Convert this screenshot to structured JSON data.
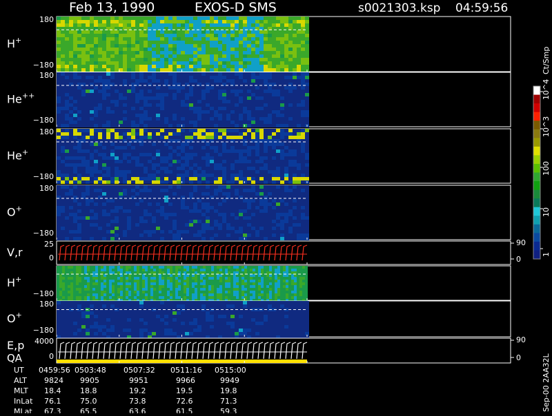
{
  "header": {
    "date": "Feb 13, 1990",
    "title": "EXOS-D SMS",
    "file": "s0021303.ksp",
    "time": "04:59:56"
  },
  "footer_stamp": "Sep-00 2AA32L",
  "colorbar": {
    "unit_label": "Ct/Smp",
    "tick_labels": [
      "10^4",
      "10^3",
      "100",
      "10",
      "1"
    ],
    "colors": [
      "#ffffff",
      "#a00000",
      "#d00000",
      "#ff2000",
      "#7a5a00",
      "#8a7a10",
      "#9a9a00",
      "#e0e000",
      "#9ad000",
      "#5ac000",
      "#30a830",
      "#10a010",
      "#1a8a3a",
      "#0a7a5a",
      "#20c8d8",
      "#10a0b0",
      "#0a6a9a",
      "#0a4aa0",
      "#0a2a90",
      "#102080"
    ]
  },
  "chart_data": {
    "type": "heatmap",
    "time_axis": {
      "labels": [
        "0459:56",
        "0503:48",
        "0507:32",
        "0511:16",
        "0515:00"
      ],
      "data_end_label": "0515:00"
    },
    "panels": [
      {
        "id": "hplus-1",
        "label": "H",
        "sup": "+",
        "ymax_label": "180",
        "ymin_label": "−180",
        "type": "spectrogram",
        "level": 0.68,
        "hot_bands": [
          0.08,
          0.92
        ],
        "cold_region": [
          0.35,
          0.82
        ]
      },
      {
        "id": "heplusplus",
        "label": "He",
        "sup": "++",
        "ymax_label": "180",
        "ymin_label": "−180",
        "type": "spectrogram",
        "level": 0.08,
        "hot_bands": [],
        "cold_region": null
      },
      {
        "id": "heplus",
        "label": "He",
        "sup": "+",
        "ymax_label": "180",
        "ymin_label": "−180",
        "type": "spectrogram",
        "level": 0.1,
        "hot_bands": [
          0.05,
          0.95
        ],
        "cold_region": null
      },
      {
        "id": "oplus-1",
        "label": "O",
        "sup": "+",
        "ymax_label": "180",
        "ymin_label": "−180",
        "type": "spectrogram",
        "level": 0.08,
        "hot_bands": [],
        "cold_region": null
      },
      {
        "id": "vr",
        "label": "V,r",
        "ymax_label": "25",
        "ymin_label": "0",
        "right_top": "90",
        "right_bottom": "0",
        "type": "trace",
        "trace_color": "#ff3020"
      },
      {
        "id": "hplus-2",
        "label": "H",
        "sup": "+",
        "ymax_label": "",
        "ymin_label": "−180",
        "type": "spectrogram",
        "level": 0.6,
        "hot_bands": [],
        "cold_region": [
          0.1,
          0.95
        ],
        "striped": true
      },
      {
        "id": "oplus-2",
        "label": "O",
        "sup": "+",
        "ymax_label": "180",
        "ymin_label": "−180",
        "type": "spectrogram",
        "level": 0.05,
        "hot_bands": [],
        "cold_region": null
      },
      {
        "id": "ep",
        "label": "E,p",
        "label2": "QA",
        "ymax_label": "4000",
        "ymin_label": "0",
        "right_top": "90",
        "right_bottom": "0",
        "type": "trace",
        "trace_color": "#ffffff",
        "qa_bar_color": "#ffe000"
      }
    ],
    "orbit_table": {
      "rows": [
        {
          "name": "UT",
          "values": [
            "0459:56",
            "0503:48",
            "0507:32",
            "0511:16",
            "0515:00"
          ]
        },
        {
          "name": "ALT",
          "values": [
            "9824",
            "9905",
            "9951",
            "9966",
            "9949"
          ]
        },
        {
          "name": "MLT",
          "values": [
            "18.4",
            "18.8",
            "19.2",
            "19.5",
            "19.8"
          ]
        },
        {
          "name": "InLat",
          "values": [
            "76.1",
            "75.0",
            "73.8",
            "72.6",
            "71.3"
          ]
        },
        {
          "name": "MLat",
          "values": [
            "67.3",
            "65.5",
            "63.6",
            "61.5",
            "59.3"
          ]
        }
      ]
    }
  }
}
